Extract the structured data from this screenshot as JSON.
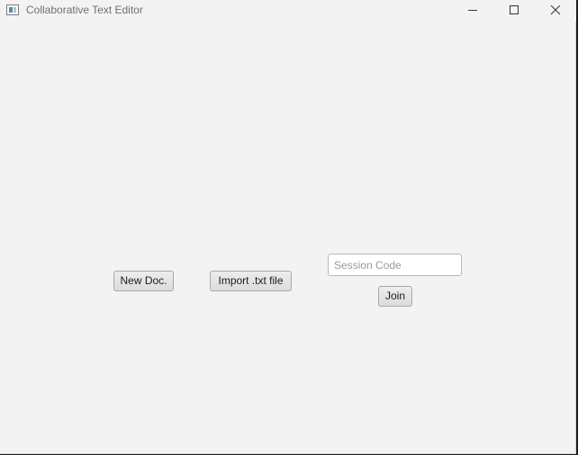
{
  "window": {
    "title": "Collaborative Text Editor",
    "controls": [
      "minimize",
      "maximize",
      "close"
    ]
  },
  "main": {
    "new_doc_label": "New Doc.",
    "import_label": "Import .txt file",
    "session_code": {
      "value": "",
      "placeholder": "Session Code"
    },
    "join_label": "Join"
  },
  "colors": {
    "window_bg": "#f3f3f3",
    "button_border": "#a9a9a9",
    "title_text": "#707070"
  }
}
